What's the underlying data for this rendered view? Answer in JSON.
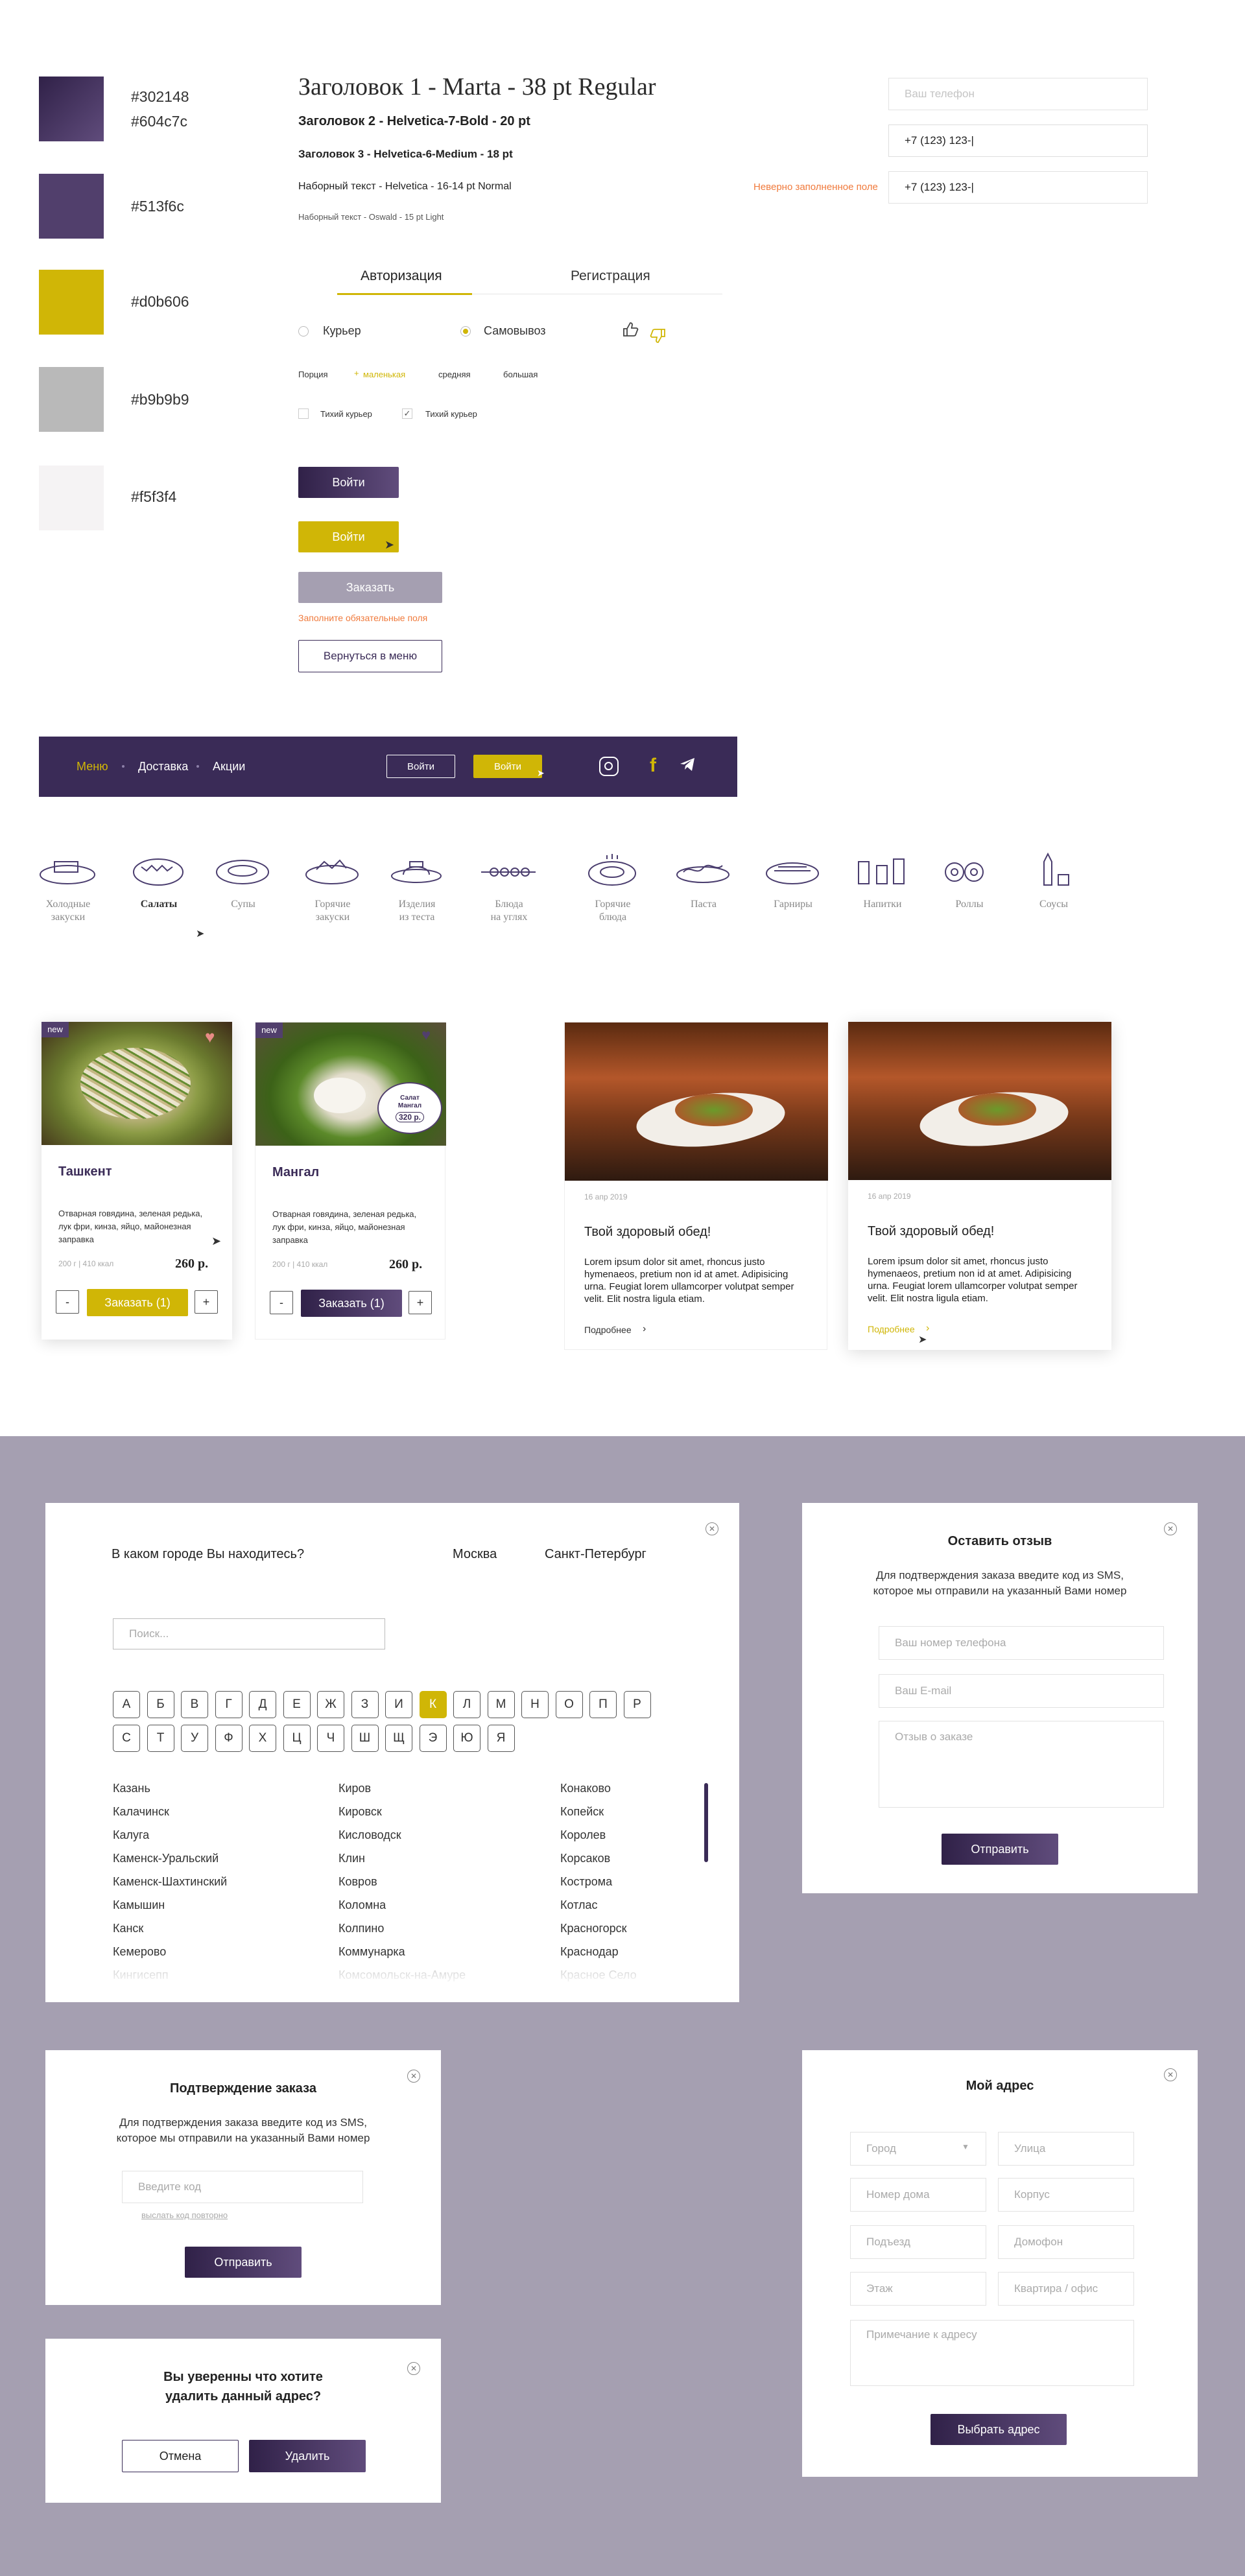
{
  "palette": [
    {
      "codes": [
        "#302148",
        "#604c7c"
      ],
      "color_a": "#302148",
      "color_b": "#604c7c"
    },
    {
      "codes": [
        "#513f6c"
      ],
      "color_a": "#513f6c",
      "color_b": "#513f6c"
    },
    {
      "codes": [
        "#d0b606"
      ],
      "color_a": "#d0b606",
      "color_b": "#d0b606"
    },
    {
      "codes": [
        "#b9b9b9"
      ],
      "color_a": "#b9b9b9",
      "color_b": "#b9b9b9"
    },
    {
      "codes": [
        "#f5f3f4"
      ],
      "color_a": "#f5f3f4",
      "color_b": "#f5f3f4"
    }
  ],
  "typography": {
    "h1": "Заголовок 1 - Marta - 38 pt Regular",
    "h2": "Заголовок 2 - Helvetica-7-Bold - 20 pt",
    "h3": "Заголовок 3 - Helvetica-6-Medium - 18 pt",
    "body": "Наборный текст - Helvetica - 16-14 pt Normal",
    "small": "Наборный текст - Oswald - 15 pt Light"
  },
  "inputs": {
    "phone_placeholder": "Ваш телефон",
    "phone_value": "+7 (123) 123-|",
    "phone_error_value": "+7 (123) 123-|",
    "error_label": "Неверно заполненное поле"
  },
  "tabs": {
    "login": "Авторизация",
    "register": "Регистрация"
  },
  "delivery": {
    "courier": "Курьер",
    "pickup": "Самовывоз"
  },
  "portion": {
    "label": "Порция",
    "small": "маленькая",
    "medium": "средняя",
    "large": "большая"
  },
  "checks": {
    "quiet1": "Тихий курьер",
    "quiet2": "Тихий курьер"
  },
  "buttons": {
    "login_dark": "Войти",
    "login_yellow": "Войти",
    "order": "Заказать",
    "required_warning": "Заполните обязательные поля",
    "back_menu": "Вернуться в меню"
  },
  "nav": {
    "menu": "Меню",
    "delivery": "Доставка",
    "promo": "Акции",
    "login1": "Войти",
    "login2": "Войти"
  },
  "categories": [
    {
      "l1": "Холодные",
      "l2": "закуски"
    },
    {
      "l1": "Салаты",
      "l2": ""
    },
    {
      "l1": "Супы",
      "l2": ""
    },
    {
      "l1": "Горячие",
      "l2": "закуски"
    },
    {
      "l1": "Изделия",
      "l2": "из теста"
    },
    {
      "l1": "Блюда",
      "l2": "на углях"
    },
    {
      "l1": "Горячие",
      "l2": "блюда"
    },
    {
      "l1": "Паста",
      "l2": ""
    },
    {
      "l1": "Гарниры",
      "l2": ""
    },
    {
      "l1": "Напитки",
      "l2": ""
    },
    {
      "l1": "Роллы",
      "l2": ""
    },
    {
      "l1": "Соусы",
      "l2": ""
    }
  ],
  "products": [
    {
      "badge": "new",
      "title": "Ташкент",
      "desc": "Отварная говядина, зеленая редька, лук фри, кинза, яйцо, майонезная заправка",
      "meta": "200 г | 410 ккал",
      "price": "260 р.",
      "minus": "-",
      "plus": "+",
      "order": "Заказать (1)"
    },
    {
      "badge": "new",
      "title": "Мангал",
      "desc": "Отварная говядина, зеленая редька, лук фри, кинза, яйцо, майонезная заправка",
      "meta": "200 г | 410 ккал",
      "price": "260 р.",
      "minus": "-",
      "plus": "+",
      "order": "Заказать (1)",
      "sticker": "Салат Мангал",
      "sticker_price": "320 р."
    }
  ],
  "news": [
    {
      "date": "16 апр 2019",
      "title": "Твой здоровый обед!",
      "text": "Lorem ipsum dolor sit amet, rhoncus justo hymenaeos, pretium non id at amet. Adipisicing urna. Feugiat lorem ullamcorper volutpat semper velit. Elit nostra ligula etiam.",
      "more": "Подробнее"
    },
    {
      "date": "16 апр 2019",
      "title": "Твой здоровый обед!",
      "text": "Lorem ipsum dolor sit amet, rhoncus justo hymenaeos, pretium non id at amet. Adipisicing urna. Feugiat lorem ullamcorper volutpat semper velit. Elit nostra ligula etiam.",
      "more": "Подробнее"
    }
  ],
  "city_modal": {
    "question": "В каком городе Вы находитесь?",
    "moscow": "Москва",
    "spb": "Санкт-Петербург",
    "search_placeholder": "Поиск...",
    "letters_row1": [
      "А",
      "Б",
      "В",
      "Г",
      "Д",
      "Е",
      "Ж",
      "З",
      "И",
      "К",
      "Л",
      "М",
      "Н",
      "О",
      "П",
      "Р"
    ],
    "letters_row2": [
      "С",
      "Т",
      "У",
      "Ф",
      "Х",
      "Ц",
      "Ч",
      "Ш",
      "Щ",
      "Э",
      "Ю",
      "Я"
    ],
    "active_letter": "К",
    "col1": [
      "Казань",
      "Калачинск",
      "Калуга",
      "Каменск-Уральский",
      "Каменск-Шахтинский",
      "Камышин",
      "Канск",
      "Кемерово",
      "Кингисепп"
    ],
    "col2": [
      "Киров",
      "Кировск",
      "Кисловодск",
      "Клин",
      "Ковров",
      "Коломна",
      "Колпино",
      "Коммунарка",
      "Комсомольск-на-Амуре"
    ],
    "col3": [
      "Конаково",
      "Копейск",
      "Королев",
      "Корсаков",
      "Кострома",
      "Котлас",
      "Красногорск",
      "Краснодар",
      "Красное Село"
    ]
  },
  "review_modal": {
    "title": "Оставить отзыв",
    "text": "Для подтверждения заказа введите код из SMS, которое мы отправили на указанный Вами номер",
    "phone": "Ваш номер телефона",
    "email": "Ваш E-mail",
    "review": "Отзыв о заказе",
    "submit": "Отправить"
  },
  "confirm_modal": {
    "title": "Подтверждение заказа",
    "text": "Для подтверждения заказа введите код из SMS, которое мы отправили на указанный Вами номер",
    "code": "Введите код",
    "resend": "выслать код повторно",
    "submit": "Отправить"
  },
  "delete_modal": {
    "question": "Вы уверенны что хотите удалить данный адрес?",
    "cancel": "Отмена",
    "delete": "Удалить"
  },
  "address_modal": {
    "title": "Мой адрес",
    "city": "Город",
    "street": "Улица",
    "house": "Номер дома",
    "building": "Корпус",
    "entrance": "Подъезд",
    "intercom": "Домофон",
    "floor": "Этаж",
    "apartment": "Квартира / офис",
    "note": "Примечание к адресу",
    "submit": "Выбрать адрес"
  }
}
